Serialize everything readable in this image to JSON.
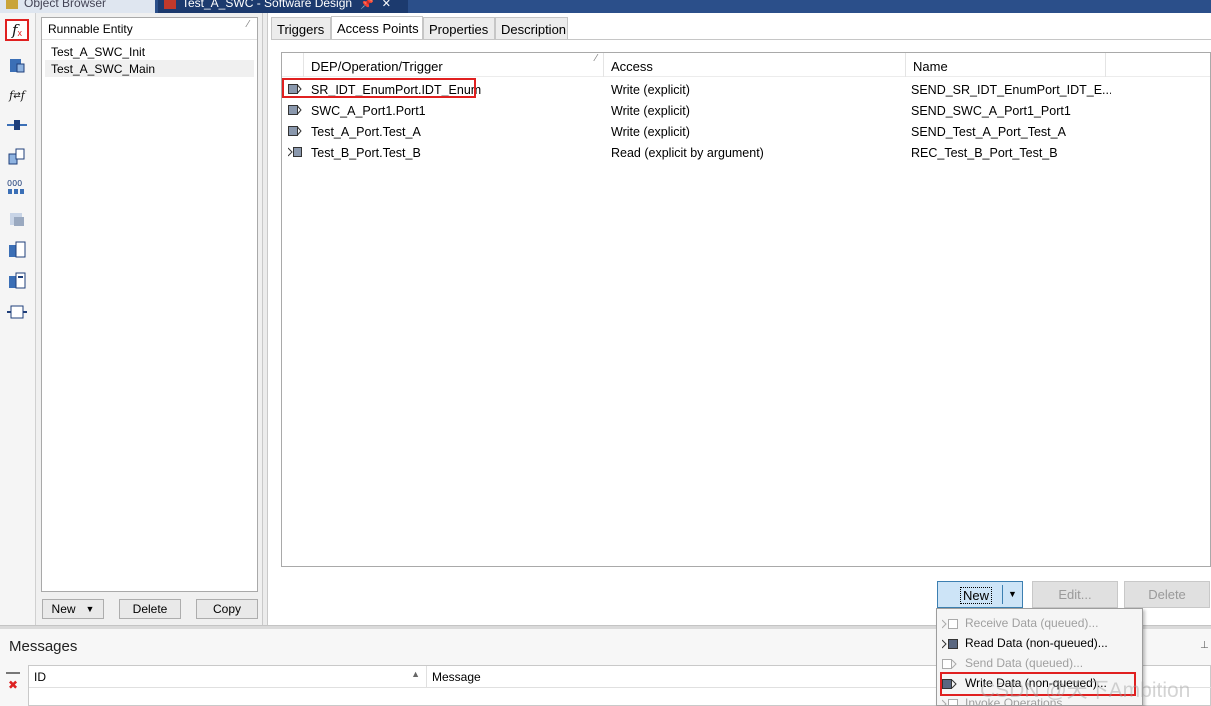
{
  "doc_tabs": {
    "object_browser": "Object Browser",
    "active": "Test_A_SWC - Software Design",
    "pin_icon": "pin-icon",
    "close_icon": "close-icon"
  },
  "runnable_panel": {
    "header": "Runnable Entity",
    "items": [
      "Test_A_SWC_Init",
      "Test_A_SWC_Main"
    ],
    "selected_index": 1,
    "buttons": {
      "new": "New",
      "delete": "Delete",
      "copy": "Copy"
    }
  },
  "tabs": [
    "Triggers",
    "Access Points",
    "Properties",
    "Description"
  ],
  "active_tab": "Access Points",
  "access_points": {
    "columns": [
      "DEP/Operation/Trigger",
      "Access",
      "Name"
    ],
    "rows": [
      {
        "dep": "SR_IDT_EnumPort.IDT_Enum",
        "access": "Write (explicit)",
        "name": "SEND_SR_IDT_EnumPort_IDT_E...",
        "icon": "write-port-icon"
      },
      {
        "dep": "SWC_A_Port1.Port1",
        "access": "Write (explicit)",
        "name": "SEND_SWC_A_Port1_Port1",
        "icon": "write-port-icon"
      },
      {
        "dep": "Test_A_Port.Test_A",
        "access": "Write (explicit)",
        "name": "SEND_Test_A_Port_Test_A",
        "icon": "write-port-icon"
      },
      {
        "dep": "Test_B_Port.Test_B",
        "access": "Read (explicit by argument)",
        "name": "REC_Test_B_Port_Test_B",
        "icon": "read-port-icon"
      }
    ]
  },
  "action_buttons": {
    "new": "New",
    "edit": "Edit...",
    "delete": "Delete"
  },
  "dropdown_menu": [
    {
      "label": "Receive Data (queued)...",
      "enabled": false,
      "icon": "receive-queued-icon"
    },
    {
      "label": "Read Data (non-queued)...",
      "enabled": true,
      "icon": "read-nonqueued-icon"
    },
    {
      "label": "Send Data (queued)...",
      "enabled": false,
      "icon": "send-queued-icon"
    },
    {
      "label": "Write Data (non-queued)...",
      "enabled": true,
      "icon": "write-nonqueued-icon"
    },
    {
      "label": "Invoke Operations...",
      "enabled": false,
      "icon": "invoke-operations-icon"
    }
  ],
  "messages": {
    "title": "Messages",
    "columns": [
      "ID",
      "Message"
    ]
  },
  "watermark": "CSDN @天下Ambition",
  "colors": {
    "highlight_red": "#e02020",
    "selection_blue": "#cde4f7",
    "active_tab_bg": "#1c3a6e"
  }
}
